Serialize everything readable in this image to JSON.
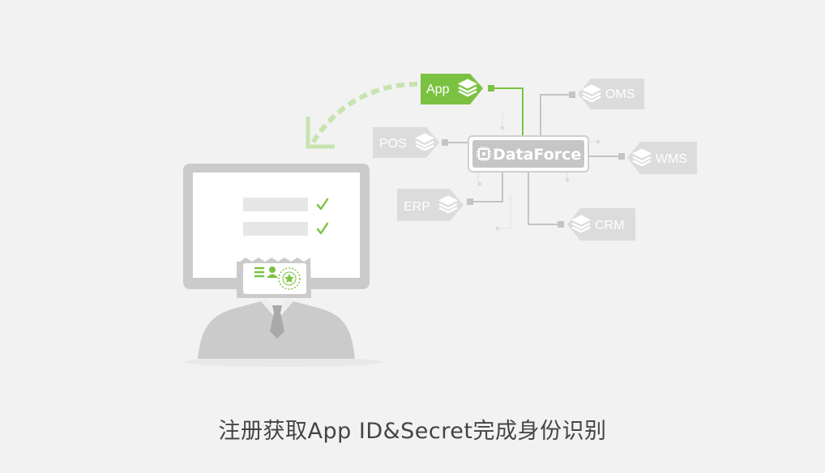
{
  "hub": {
    "label": "DataForce"
  },
  "tags": {
    "app": "App",
    "oms": "OMS",
    "pos": "POS",
    "wms": "WMS",
    "erp": "ERP",
    "crm": "CRM"
  },
  "caption": "注册获取App ID&Secret完成身份识别",
  "colors": {
    "accent_green": "#7cc242",
    "light_green": "#c8e3b0",
    "gray_tag": "#dcdcdc",
    "gray_line": "#c4c4c4",
    "background": "#f2f2f2"
  }
}
